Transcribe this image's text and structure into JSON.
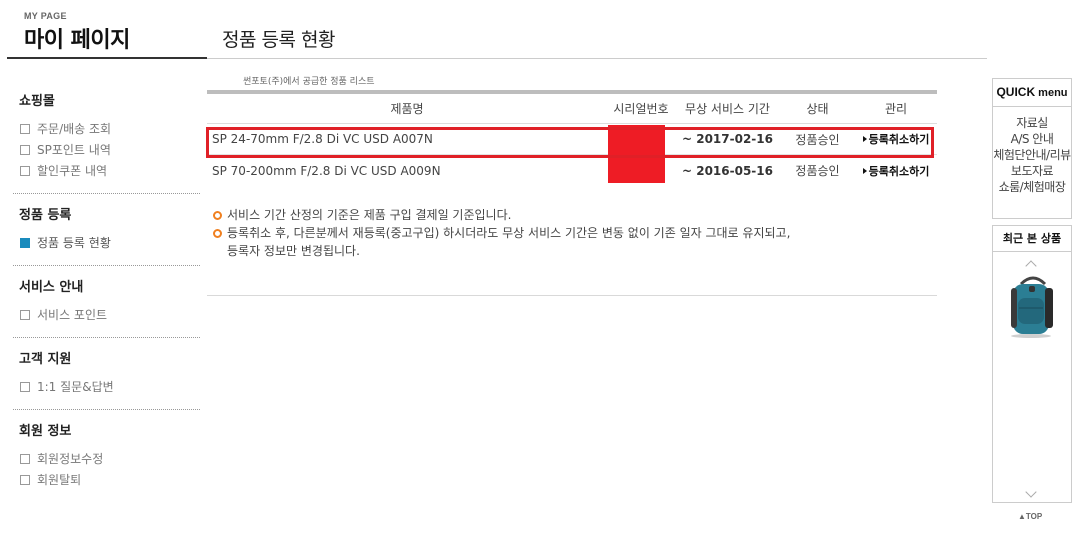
{
  "header": {
    "mypage_small": "MY PAGE",
    "mypage_title": "마이 페이지",
    "page_title": "정품 등록 현황"
  },
  "sidebar": {
    "sections": [
      {
        "title": "쇼핑몰",
        "items": [
          "주문/배송 조회",
          "SP포인트 내역",
          "할인쿠폰 내역"
        ]
      },
      {
        "title": "정품 등록",
        "items": [
          "정품 등록 현황"
        ]
      },
      {
        "title": "서비스 안내",
        "items": [
          "서비스 포인트"
        ]
      },
      {
        "title": "고객 지원",
        "items": [
          "1:1 질문&답변"
        ]
      },
      {
        "title": "회원 정보",
        "items": [
          "회원정보수정",
          "회원탈퇴"
        ]
      }
    ],
    "active_item": "정품 등록 현황"
  },
  "main": {
    "caption": "썬포토(주)에서 공급한 정품 리스트",
    "columns": [
      "제품명",
      "시리얼번호",
      "무상 서비스 기간",
      "상태",
      "관리"
    ],
    "rows": [
      {
        "product": "SP 24-70mm F/2.8 Di VC USD A007N",
        "serial": "",
        "period": "~ 2017-02-16",
        "status": "정품승인",
        "action": "등록취소하기",
        "highlighted": true
      },
      {
        "product": "SP 70-200mm F/2.8 Di VC USD A009N",
        "serial": "",
        "period": "~ 2016-05-16",
        "status": "정품승인",
        "action": "등록취소하기",
        "highlighted": false
      }
    ],
    "notes": [
      "서비스 기간 산정의 기준은 제품 구입 결제일 기준입니다.",
      "등록취소 후, 다른분께서 재등록(중고구입) 하시더라도 무상 서비스 기간은 변동 없이 기존 일자 그대로 유지되고,\n등록자 정보만 변경됩니다."
    ]
  },
  "quick_menu": {
    "title_bold": "QUICK",
    "title_rest": " menu",
    "items": [
      "자료실",
      "A/S 안내",
      "체험단안내/리뷰",
      "보도자료",
      "쇼룸/체험매장"
    ],
    "recent_title": "최근 본 상품",
    "recent_item_icon": "backpack-product-image",
    "top_label": "▲TOP"
  },
  "colors": {
    "highlight_border": "#e02027",
    "redaction": "#ee1c25",
    "active_box": "#1a8bbd",
    "note_bullet": "#f08020"
  }
}
